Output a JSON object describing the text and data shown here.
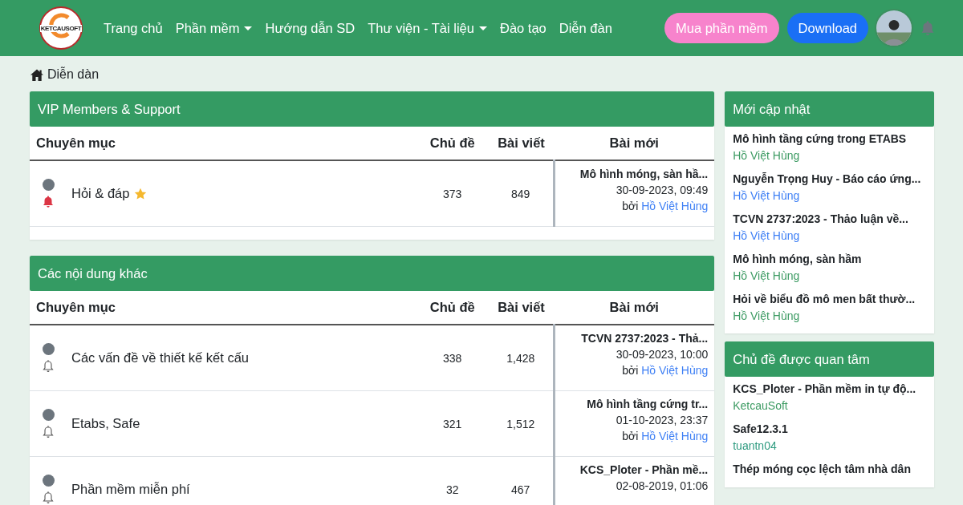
{
  "navbar": {
    "logo_text": "KETCAUSOFT",
    "links": [
      {
        "label": "Trang chủ",
        "dropdown": false
      },
      {
        "label": "Phần mềm",
        "dropdown": true
      },
      {
        "label": "Hướng dẫn SD",
        "dropdown": false
      },
      {
        "label": "Thư viện - Tài liệu",
        "dropdown": true
      },
      {
        "label": "Đào tạo",
        "dropdown": false
      },
      {
        "label": "Diễn đàn",
        "dropdown": false
      }
    ],
    "buttons": [
      {
        "label": "Mua phần mềm",
        "kind": "pink"
      },
      {
        "label": "Download",
        "kind": "primary"
      }
    ]
  },
  "breadcrumb": "Diễn dàn",
  "sections": [
    {
      "title": "VIP Members & Support",
      "columns": [
        "Chuyên mục",
        "Chủ đề",
        "Bài viết",
        "Bài mới"
      ],
      "rows": [
        {
          "name": "Hỏi & đáp",
          "starred": true,
          "subscribed": true,
          "topics": "373",
          "posts": "849",
          "latest_title": "Mô hình móng, sàn hầ...",
          "latest_time": "30-09-2023, 09:49",
          "by": "bởi",
          "author": "Hồ Việt Hùng"
        }
      ]
    },
    {
      "title": "Các nội dung khác",
      "columns": [
        "Chuyên mục",
        "Chủ đề",
        "Bài viết",
        "Bài mới"
      ],
      "rows": [
        {
          "name": "Các vấn đề về thiết kế kết cấu",
          "starred": false,
          "subscribed": false,
          "topics": "338",
          "posts": "1,428",
          "latest_title": "TCVN 2737:2023 - Thả...",
          "latest_time": "30-09-2023, 10:00",
          "by": "bởi",
          "author": "Hồ Việt Hùng"
        },
        {
          "name": "Etabs, Safe",
          "starred": false,
          "subscribed": false,
          "topics": "321",
          "posts": "1,512",
          "latest_title": "Mô hình tầng cứng tr...",
          "latest_time": "01-10-2023, 23:37",
          "by": "bởi",
          "author": "Hồ Việt Hùng"
        },
        {
          "name": "Phần mềm miễn phí",
          "starred": false,
          "subscribed": false,
          "topics": "32",
          "posts": "467",
          "latest_title": "KCS_Ploter - Phần mề...",
          "latest_time": "02-08-2019, 01:06"
        }
      ]
    }
  ],
  "sidebar": [
    {
      "title": "Mới cập nhật",
      "items": [
        {
          "title": "Mô hình tầng cứng trong ETABS",
          "author": "Hồ Việt Hùng",
          "color": "#3d9b63"
        },
        {
          "title": "Nguyễn Trọng Huy - Báo cáo ứng...",
          "author": "Hồ Việt Hùng",
          "color": "#3d7ff5"
        },
        {
          "title": "TCVN 2737:2023 - Thảo luận về...",
          "author": "Hồ Việt Hùng",
          "color": "#3d7ff5"
        },
        {
          "title": "Mô hình móng, sàn hầm",
          "author": "Hồ Việt Hùng",
          "color": "#3d9b63"
        },
        {
          "title": "Hỏi về biểu đồ mô men bất thườ...",
          "author": "Hồ Việt Hùng",
          "color": "#3d9b63"
        }
      ]
    },
    {
      "title": "Chủ đề được quan tâm",
      "items": [
        {
          "title": "KCS_Ploter - Phần mềm in tự độ...",
          "author": "KetcauSoft",
          "color": "#3d9b63"
        },
        {
          "title": "Safe12.3.1",
          "author": "tuantn04",
          "color": "#2f9b80"
        },
        {
          "title": "Thép móng cọc lệch tâm nhà dân"
        }
      ]
    }
  ]
}
